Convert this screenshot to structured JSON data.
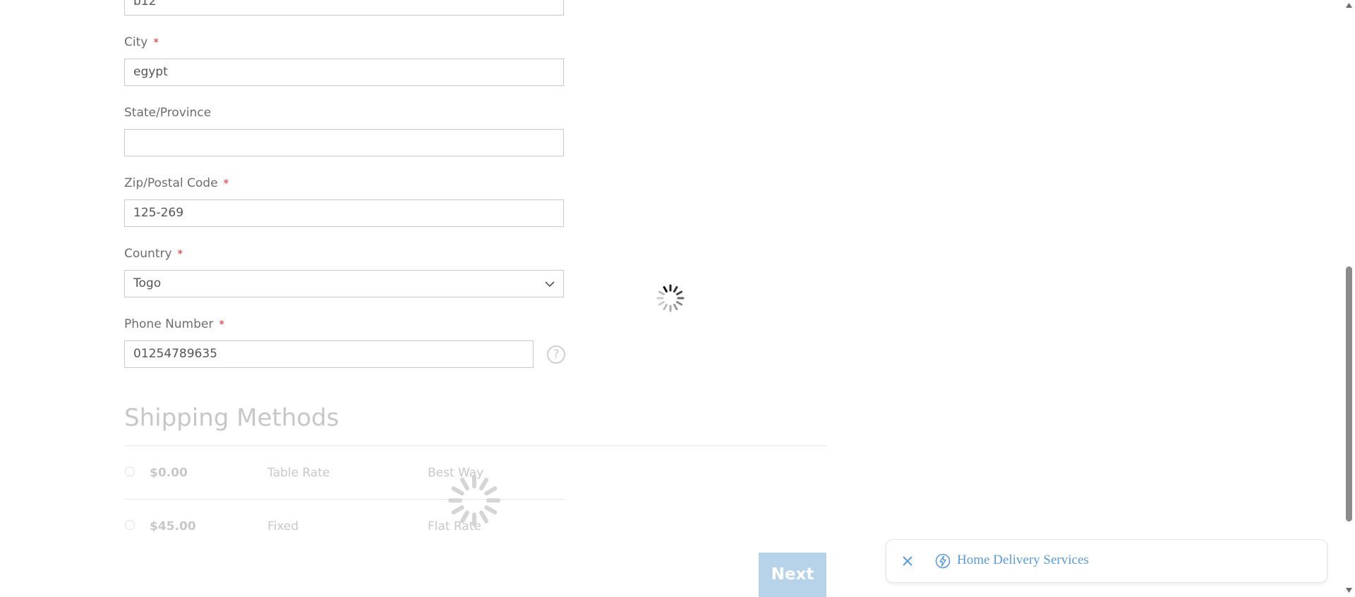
{
  "form": {
    "street_value": "b12",
    "city": {
      "label": "City",
      "required": "*",
      "value": "egypt"
    },
    "state": {
      "label": "State/Province",
      "value": ""
    },
    "zip": {
      "label": "Zip/Postal Code",
      "required": "*",
      "value": "125-269"
    },
    "country": {
      "label": "Country",
      "required": "*",
      "value": "Togo"
    },
    "phone": {
      "label": "Phone Number",
      "required": "*",
      "value": "01254789635",
      "help": "?"
    }
  },
  "shipping": {
    "title": "Shipping Methods",
    "methods": [
      {
        "price": "$0.00",
        "method": "Table Rate",
        "carrier": "Best Way"
      },
      {
        "price": "$45.00",
        "method": "Fixed",
        "carrier": "Flat Rate"
      }
    ]
  },
  "actions": {
    "next_label": "Next"
  },
  "toast": {
    "text": "Home Delivery Services"
  },
  "colors": {
    "required": "#e02b27",
    "next_bg": "#b7d3ea",
    "toast_accent": "#5b9bd5"
  },
  "icons": {
    "spinner": "loading-spinner-icon",
    "close": "close-icon",
    "bolt": "lightning-icon",
    "chevron": "chevron-down-icon",
    "help": "help-icon"
  }
}
